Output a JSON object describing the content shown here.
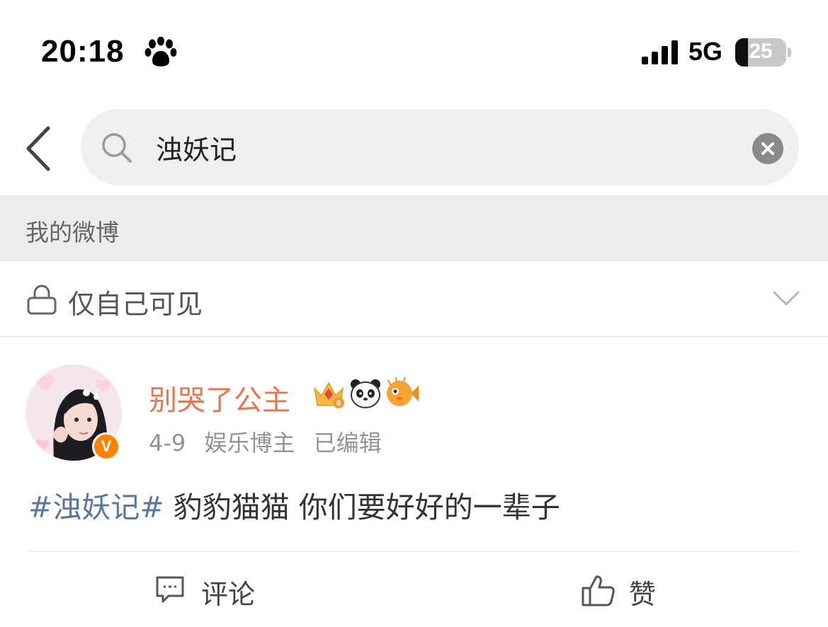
{
  "status_bar": {
    "time": "20:18",
    "network": "5G",
    "battery": "25",
    "battery_level": 0.25
  },
  "search": {
    "query": "浊妖记",
    "placeholder": ""
  },
  "section": {
    "title": "我的微博"
  },
  "visibility": {
    "label": "仅自己可见"
  },
  "post": {
    "username": "别哭了公主",
    "date": "4-9",
    "role": "娱乐博主",
    "edited": "已编辑",
    "verified_mark": "V",
    "hashtag": "#浊妖记#",
    "text": " 豹豹猫猫 你们要好好的一辈子",
    "actions": {
      "comment": "评论",
      "like": "赞"
    }
  },
  "colors": {
    "username": "#eb7350",
    "hashtag": "#5a76a6",
    "verified": "#ff8200"
  },
  "icons": [
    "paw-icon",
    "signal-icon",
    "back-icon",
    "search-icon",
    "clear-icon",
    "lock-icon",
    "chevron-down-icon",
    "crown-badge-icon",
    "panda-badge-icon",
    "fish-badge-icon",
    "comment-icon",
    "like-icon"
  ]
}
